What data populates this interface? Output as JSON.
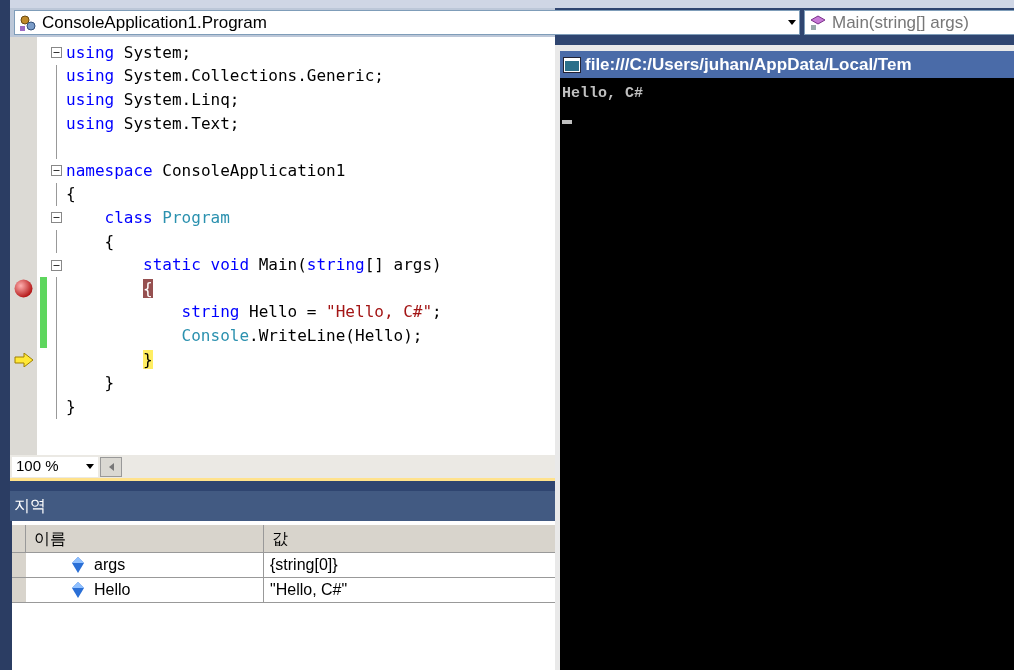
{
  "navigation": {
    "type_combo": "ConsoleApplication1.Program",
    "member_combo": "Main(string[] args)"
  },
  "editor": {
    "lines": [
      {
        "fold": true,
        "changed": false,
        "breakpoint": false,
        "current": false,
        "tokens": [
          {
            "text": "using",
            "kind": "keyword"
          },
          {
            "text": " System;",
            "kind": "plain"
          }
        ]
      },
      {
        "fold": false,
        "changed": false,
        "breakpoint": false,
        "current": false,
        "tokens": [
          {
            "text": "using",
            "kind": "keyword"
          },
          {
            "text": " System.Collections.Generic;",
            "kind": "plain"
          }
        ]
      },
      {
        "fold": false,
        "changed": false,
        "breakpoint": false,
        "current": false,
        "tokens": [
          {
            "text": "using",
            "kind": "keyword"
          },
          {
            "text": " System.Linq;",
            "kind": "plain"
          }
        ]
      },
      {
        "fold": false,
        "changed": false,
        "breakpoint": false,
        "current": false,
        "tokens": [
          {
            "text": "using",
            "kind": "keyword"
          },
          {
            "text": " System.Text;",
            "kind": "plain"
          }
        ]
      },
      {
        "fold": false,
        "changed": false,
        "breakpoint": false,
        "current": false
      },
      {
        "fold": true,
        "changed": false,
        "breakpoint": false,
        "current": false,
        "tokens": [
          {
            "text": "namespace",
            "kind": "keyword"
          },
          {
            "text": " ConsoleApplication1",
            "kind": "plain"
          }
        ]
      },
      {
        "fold": false,
        "changed": false,
        "breakpoint": false,
        "current": false,
        "tokens": [
          {
            "text": "{",
            "kind": "plain"
          }
        ]
      },
      {
        "fold": true,
        "changed": false,
        "breakpoint": false,
        "current": false,
        "tokens": [
          {
            "text": "    class",
            "kind": "keyword"
          },
          {
            "text": " Program",
            "kind": "type"
          }
        ]
      },
      {
        "fold": false,
        "changed": false,
        "breakpoint": false,
        "current": false,
        "tokens": [
          {
            "text": "    {",
            "kind": "plain"
          }
        ]
      },
      {
        "fold": true,
        "changed": false,
        "breakpoint": false,
        "current": false,
        "tokens": [
          {
            "text": "        static void",
            "kind": "keyword"
          },
          {
            "text": " Main(",
            "kind": "plain"
          },
          {
            "text": "string",
            "kind": "keyword"
          },
          {
            "text": "[] args)",
            "kind": "plain"
          }
        ]
      },
      {
        "fold": false,
        "changed": true,
        "breakpoint": true,
        "current": false,
        "tokens": [
          {
            "text": "        {",
            "kind": "brace"
          }
        ]
      },
      {
        "fold": false,
        "changed": true,
        "breakpoint": false,
        "current": false,
        "tokens": [
          {
            "text": "            string",
            "kind": "keyword"
          },
          {
            "text": " Hello = ",
            "kind": "plain"
          },
          {
            "text": "\"Hello, C#\"",
            "kind": "string"
          },
          {
            "text": ";",
            "kind": "plain"
          }
        ]
      },
      {
        "fold": false,
        "changed": true,
        "breakpoint": false,
        "current": false,
        "tokens": [
          {
            "text": "            Console",
            "kind": "type"
          },
          {
            "text": ".WriteLine(Hello);",
            "kind": "plain"
          }
        ]
      },
      {
        "fold": false,
        "changed": false,
        "breakpoint": false,
        "current": true,
        "tokens": [
          {
            "text": "        }",
            "kind": "brace"
          }
        ]
      },
      {
        "fold": false,
        "changed": false,
        "breakpoint": false,
        "current": false,
        "tokens": [
          {
            "text": "    }",
            "kind": "plain"
          }
        ]
      },
      {
        "fold": false,
        "changed": false,
        "breakpoint": false,
        "current": false,
        "tokens": [
          {
            "text": "}",
            "kind": "plain"
          }
        ]
      }
    ]
  },
  "zoom": "100 %",
  "console": {
    "title": "file:///C:/Users/juhan/AppData/Local/Tem",
    "output": [
      "Hello, C#"
    ]
  },
  "locals": {
    "title": "지역",
    "columns": [
      "이름",
      "값"
    ],
    "rows": [
      {
        "name": "args",
        "value": "{string[0]}"
      },
      {
        "name": "Hello",
        "value": "\"Hello, C#\""
      }
    ]
  }
}
